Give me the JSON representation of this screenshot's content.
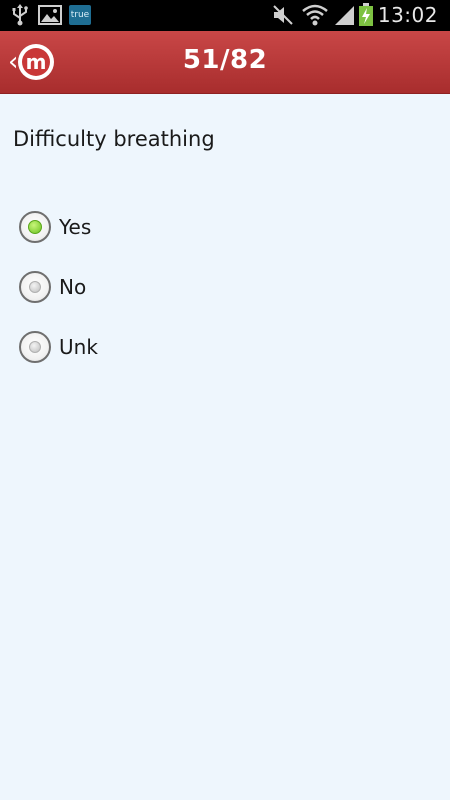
{
  "status_bar": {
    "time": "13:02",
    "badge": "true",
    "icons": [
      "usb-icon",
      "image-icon",
      "true-app-icon",
      "mute-icon",
      "wifi-icon",
      "signal-icon",
      "battery-charging-icon"
    ]
  },
  "header": {
    "title": "51/82",
    "back_icon": "chevron-left-icon",
    "logo_letter": "m",
    "brand_color": "#b83737"
  },
  "question": {
    "text": "Difficulty breathing",
    "options": [
      {
        "label": "Yes",
        "selected": true
      },
      {
        "label": "No",
        "selected": false
      },
      {
        "label": "Unk",
        "selected": false
      }
    ]
  }
}
